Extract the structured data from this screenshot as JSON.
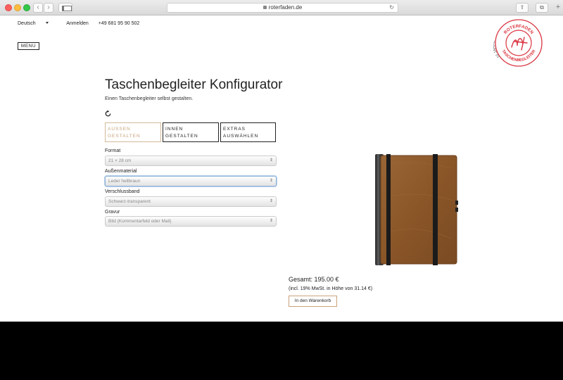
{
  "browser": {
    "url": "roterfaden.de",
    "back_glyph": "‹",
    "forward_glyph": "›",
    "reload_glyph": "↻",
    "share_glyph": "⇪",
    "tabs_glyph": "⧉",
    "new_tab_glyph": "+"
  },
  "topnav": {
    "language": "Deutsch",
    "login": "Anmelden",
    "phone": "+49 681 95 90 502"
  },
  "menu_label": "MENU",
  "logo": {
    "arc_top": "ROTERFADEN",
    "arc_bottom": "TASCHENBEGLEITER",
    "side_text": "10 JAHRE",
    "color": "#d9343f"
  },
  "configurator": {
    "title": "Taschenbegleiter Konfigurator",
    "subtitle": "Einen Taschenbegleiter selbst gestalten.",
    "steps": [
      {
        "line1": "AUSSEN",
        "line2": "GESTALTEN",
        "active": true
      },
      {
        "line1": "INNEN",
        "line2": "GESTALTEN",
        "active": false
      },
      {
        "line1": "EXTRAS",
        "line2": "AUSWÄHLEN",
        "active": false
      }
    ],
    "fields": [
      {
        "label": "Format",
        "value": "21 × 28 cm"
      },
      {
        "label": "Außenmaterial",
        "value": "Leder hellbraun"
      },
      {
        "label": "Verschlussband",
        "value": "Schwarz-transparent"
      },
      {
        "label": "Gravur",
        "value": "Bild (Kommentarfeld oder Mail)"
      }
    ]
  },
  "price": {
    "total": "Gesamt: 195.00 €",
    "vat_note": "(incl. 19% MwSt. in Höhe von 31.14 €)",
    "cart_button": "In den Warenkorb"
  },
  "colors": {
    "accent": "#c9a27a",
    "leather": "#8b5a30",
    "logo_red": "#d9343f"
  }
}
